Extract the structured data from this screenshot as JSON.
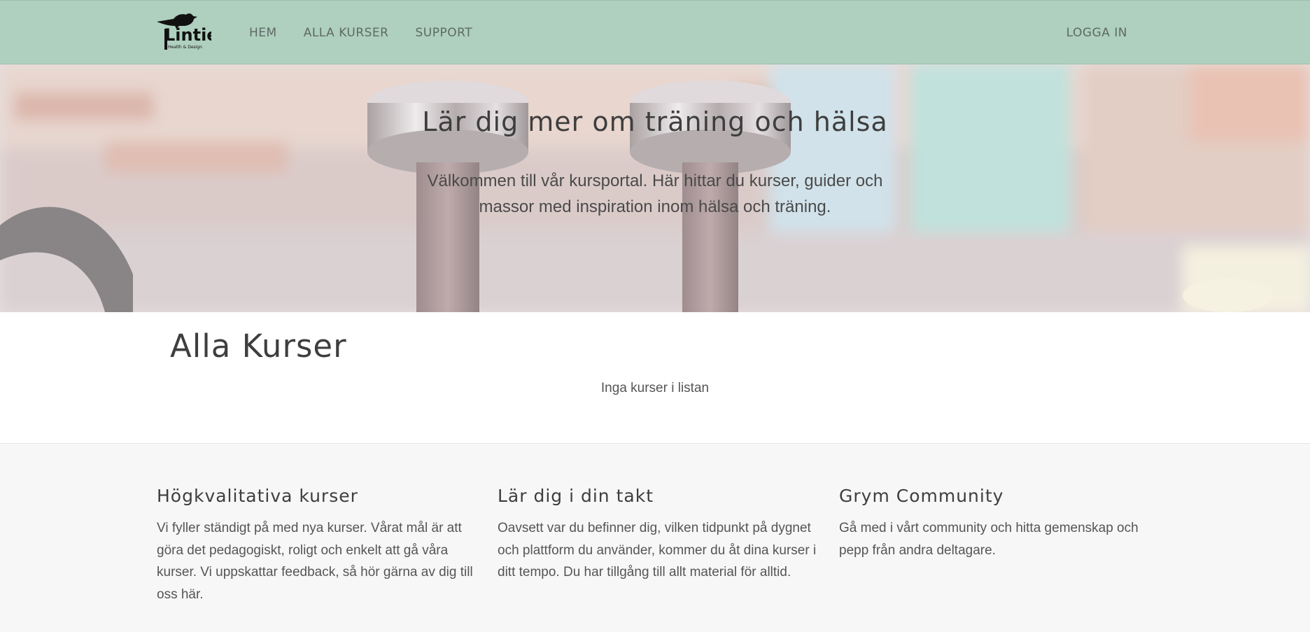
{
  "brand": {
    "logo_text": "Lintie",
    "logo_tagline": "Health & Design"
  },
  "nav": {
    "items": [
      {
        "label": "HEM"
      },
      {
        "label": "ALLA KURSER"
      },
      {
        "label": "SUPPORT"
      }
    ],
    "login_label": "LOGGA IN"
  },
  "hero": {
    "title": "Lär dig mer om träning och hälsa",
    "subtitle": "Välkommen till vår kursportal. Här hittar du kurser, guider och massor med inspiration inom hälsa och träning."
  },
  "courses": {
    "title": "Alla Kurser",
    "empty_text": "Inga kurser i listan"
  },
  "features": [
    {
      "title": "Högkvalitativa kurser",
      "text": "Vi fyller ständigt på med nya kurser. Vårat mål är att göra det pedagogiskt, roligt och enkelt att gå våra kurser. Vi uppskattar feedback, så hör gärna av dig till oss här."
    },
    {
      "title": "Lär dig i din takt",
      "text": "Oavsett var du befinner dig, vilken tidpunkt på dygnet och plattform du använder, kommer du åt dina kurser i ditt tempo. Du har tillgång till allt material för alltid."
    },
    {
      "title": "Grym Community",
      "text": "Gå med i vårt community och hitta gemenskap och pepp från andra deltagare."
    }
  ],
  "colors": {
    "navbar": "#afcfbf",
    "page_bg": "#f7f7f7",
    "heading": "#3e3e3e",
    "text": "#555555"
  }
}
